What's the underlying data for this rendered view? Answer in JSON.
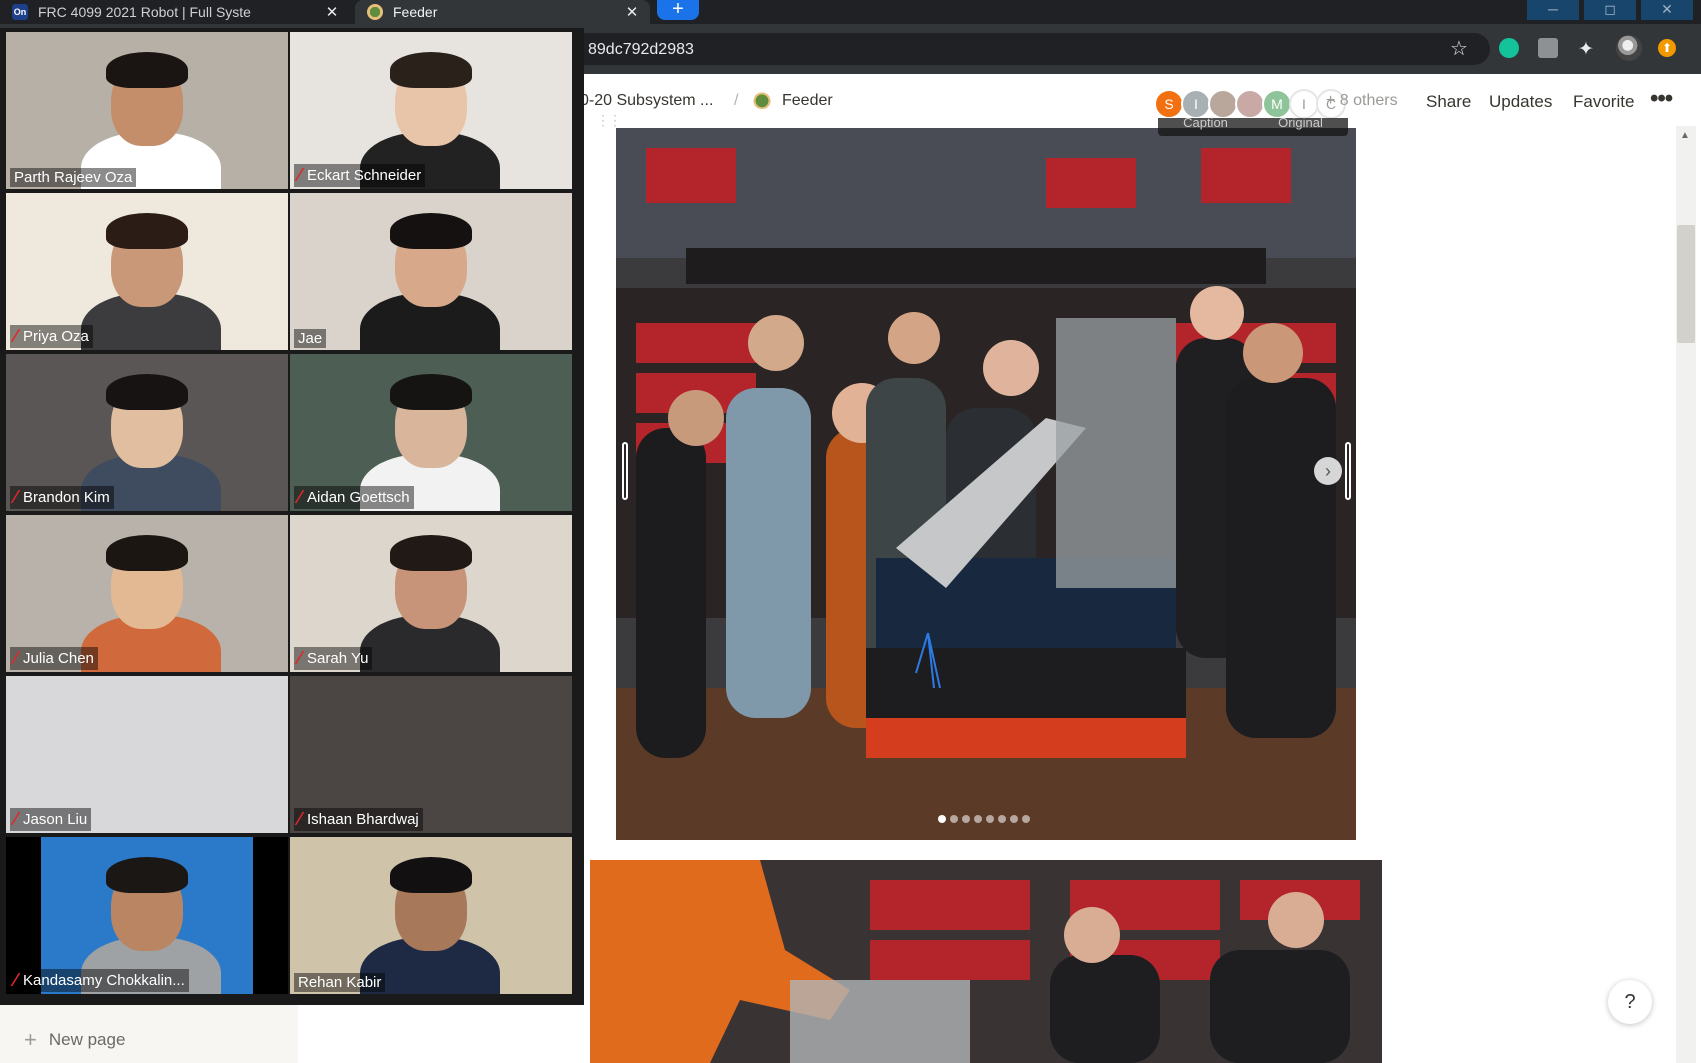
{
  "browser": {
    "tabs": [
      {
        "label": "FRC 4099 2021 Robot | Full Syste",
        "favicon": "onshape-icon",
        "color": "#1e3f8a"
      },
      {
        "label": "Feeder",
        "favicon": "notion-page-icon",
        "color": "#5f8d3d"
      }
    ],
    "new_tab": "+",
    "url": "89dc792d2983",
    "window_controls": [
      "─",
      "◻",
      "✕"
    ]
  },
  "notion": {
    "breadcrumb_parent": "0-20 Subsystem ...",
    "breadcrumb_sep": "/",
    "page_title": "Feeder",
    "presence": [
      {
        "initial": "S",
        "color": "#f2700f"
      },
      {
        "initial": "I",
        "color": "#a8b0b4"
      },
      {
        "initial": "",
        "color": "#b8a79a"
      },
      {
        "initial": "",
        "color": "#c9a9a6"
      },
      {
        "initial": "M",
        "color": "#8fc49a"
      },
      {
        "initial": "I",
        "color": "#e5e5e5"
      },
      {
        "initial": "C",
        "color": "#e5e5e5"
      }
    ],
    "others": "+ 8 others",
    "share": "Share",
    "updates": "Updates",
    "favorite": "Favorite",
    "more": "•••",
    "image_tools": [
      "Caption",
      "Original"
    ],
    "carousel_dots": 8,
    "carousel_active_dot": 0,
    "help": "?",
    "new_page": "New page"
  },
  "zoom": {
    "participants": [
      {
        "name": "Parth Rajeev Oza",
        "muted": false,
        "active": true
      },
      {
        "name": "Eckart Schneider",
        "muted": true,
        "active": false
      },
      {
        "name": "Priya Oza",
        "muted": true,
        "active": false
      },
      {
        "name": "Jae",
        "muted": false,
        "active": false
      },
      {
        "name": "Brandon Kim",
        "muted": true,
        "active": false
      },
      {
        "name": "Aidan Goettsch",
        "muted": true,
        "active": false
      },
      {
        "name": "Julia Chen",
        "muted": true,
        "active": false
      },
      {
        "name": "Sarah Yu",
        "muted": true,
        "active": false
      },
      {
        "name": "Jason Liu",
        "muted": true,
        "active": false
      },
      {
        "name": "Ishaan Bhardwaj",
        "muted": true,
        "active": false
      },
      {
        "name": "Kandasamy Chokkalin...",
        "muted": true,
        "active": false
      },
      {
        "name": "Rehan Kabir",
        "muted": false,
        "active": false
      }
    ]
  }
}
